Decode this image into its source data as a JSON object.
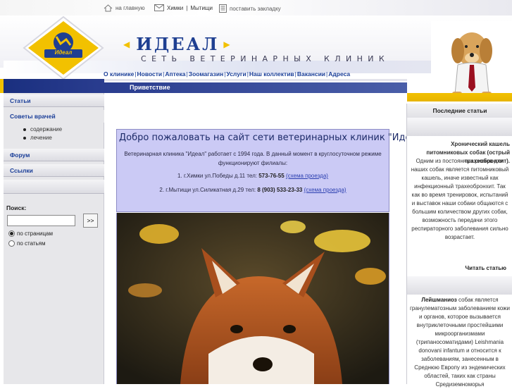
{
  "topbar": {
    "home_label": "на главную",
    "cities_label_1": "Химки",
    "cities_sep": "|",
    "cities_label_2": "Мытищи",
    "bookmark_label": "поставить закладку"
  },
  "brand": {
    "logo_text": "Идеал",
    "title": "ИДЕАЛ",
    "subtitle": "СЕТЬ ВЕТЕРИНАРНЫХ КЛИНИК",
    "accent_color": "#f2c100",
    "brand_color": "#1f3f91"
  },
  "nav": {
    "items": [
      "О клинике",
      "Новости",
      "Аптека",
      "Зоомагазин",
      "Услуги",
      "Наш коллектив",
      "Вакансии",
      "Адреса"
    ],
    "separator": "|"
  },
  "greeting_bar": "Приветствие",
  "sidebar": {
    "articles": "Статьи",
    "advice": "Советы врачей",
    "sub_items": [
      "содержание",
      "лечение"
    ],
    "forum": "Форум",
    "links": "Ссылки",
    "search_label": "Поиск:",
    "search_value": "",
    "search_button": ">>",
    "radio_pages": "по страницам",
    "radio_articles": "по статьям"
  },
  "welcome": {
    "title": "Добро пожаловать на сайт сети ветеринарных клиник \"Идеал\"!",
    "intro": "Ветеринарная клиника \"Идеал\" работает с 1994 года. В данный момент в круглосуточном режиме функционируют филиалы:",
    "branch1_text": "1. г.Химки ул.Победы д.11 тел:",
    "branch1_phone": "573-76-55",
    "branch1_link": "(схема проезда)",
    "branch2_text": "2. г.Мытищи ул.Силикатная д.29 тел:",
    "branch2_phone": "8 (903) 533-23-33",
    "branch2_link": "(схема проезда)"
  },
  "right": {
    "header": "Последние статьи",
    "article1_title": "Хронический кашель питомниковых собак (острый трахеобронхит).",
    "article1_body": "Одним из постоянных рисков для наших собак является питомниковый кашель, иначе известный как инфекционный трахеобронхит. Так как во время тренировок, испытаний и выставок наши собаки общаются с большим количеством других собак, возможность передачи этого респираторного заболевания сильно возрастает.",
    "read_more": "Читать статью",
    "article2_title": "Лейшманиоз",
    "article2_body": "собак является гранулематозным заболеванием кожи и органов, которое вызывается внутриклеточными простейшими микроорганизмами (трипаносоматидами) Leishmania donovani infantum и относится к заболеваниям, занесенным в Среднюю Европу из эндемических областей, таких как страны Средиземноморья"
  }
}
